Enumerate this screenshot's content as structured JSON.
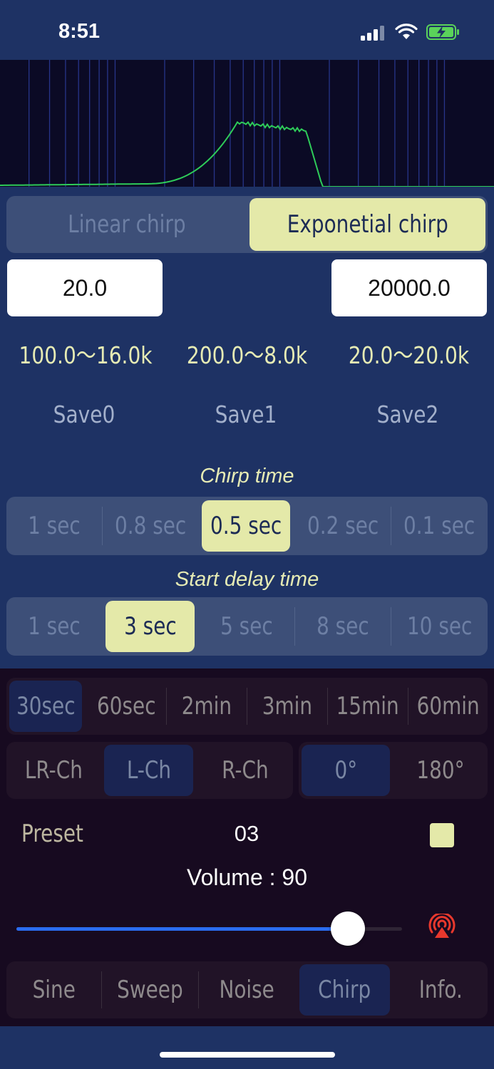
{
  "status_bar": {
    "time": "8:51",
    "battery_color": "#5ad35a"
  },
  "chirp_mode": {
    "options": [
      "Linear chirp",
      "Exponetial chirp"
    ],
    "selected_index": 1
  },
  "frequency": {
    "start": "20.0",
    "end": "20000.0"
  },
  "ranges": [
    "100.0〜16.0k",
    "200.0〜8.0k",
    "20.0〜20.0k"
  ],
  "saves": [
    "Save0",
    "Save1",
    "Save2"
  ],
  "chirp_time": {
    "label": "Chirp time",
    "options": [
      "1 sec",
      "0.8 sec",
      "0.5 sec",
      "0.2 sec",
      "0.1 sec"
    ],
    "selected_index": 2
  },
  "start_delay": {
    "label": "Start delay time",
    "options": [
      "1 sec",
      "3 sec",
      "5 sec",
      "8 sec",
      "10 sec"
    ],
    "selected_index": 1
  },
  "timer": {
    "options": [
      "30sec",
      "60sec",
      "2min",
      "3min",
      "15min",
      "60min"
    ],
    "selected_index": 0
  },
  "channel": {
    "options": [
      "LR-Ch",
      "L-Ch",
      "R-Ch"
    ],
    "selected_index": 1
  },
  "phase": {
    "options": [
      "0°",
      "180°"
    ],
    "selected_index": 0
  },
  "preset": {
    "label": "Preset",
    "value": "03"
  },
  "volume": {
    "label": "Volume : 90",
    "value": 90,
    "max": 100,
    "fill_fraction": 0.9
  },
  "tabs": {
    "options": [
      "Sine",
      "Sweep",
      "Noise",
      "Chirp",
      "Info."
    ],
    "selected_index": 3
  },
  "colors": {
    "accent": "#e4e9a9",
    "slider": "#2a6cf0",
    "airplay": "#e8382d",
    "spectrum_line": "#2ecc59"
  }
}
